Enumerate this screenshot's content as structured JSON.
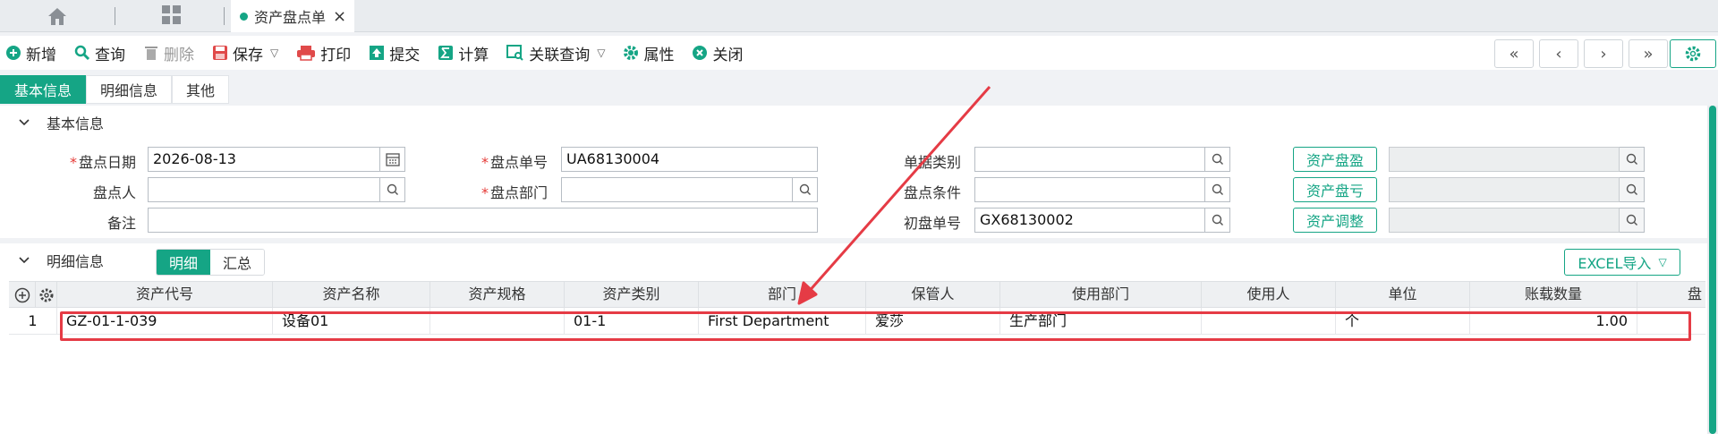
{
  "tabbar": {
    "active_tab": "资产盘点单",
    "close_glyph": "×"
  },
  "toolbar": {
    "new": "新增",
    "query": "查询",
    "delete": "删除",
    "save": "保存",
    "print": "打印",
    "submit": "提交",
    "calculate": "计算",
    "related_query": "关联查询",
    "properties": "属性",
    "close": "关闭",
    "nav_first": "«",
    "nav_prev": "‹",
    "nav_next": "›",
    "nav_last": "»"
  },
  "section_tabs": [
    "基本信息",
    "明细信息",
    "其他"
  ],
  "basic": {
    "title": "基本信息",
    "fields": {
      "date_label": "盘点日期",
      "date_value": "2026-08-13",
      "number_label": "盘点单号",
      "number_value": "UA68130004",
      "doc_type_label": "单据类别",
      "doc_type_value": "",
      "person_label": "盘点人",
      "person_value": "",
      "dept_label": "盘点部门",
      "dept_value": "",
      "condition_label": "盘点条件",
      "condition_value": "",
      "remark_label": "备注",
      "remark_value": "",
      "initial_no_label": "初盘单号",
      "initial_no_value": "GX68130002"
    },
    "buttons": {
      "surplus": "资产盘盈",
      "loss": "资产盘亏",
      "adjust": "资产调整"
    }
  },
  "detail": {
    "title": "明细信息",
    "subtabs": [
      "明细",
      "汇总"
    ],
    "excel_import": "EXCEL导入",
    "columns": [
      "资产代号",
      "资产名称",
      "资产规格",
      "资产类别",
      "部门",
      "保管人",
      "使用部门",
      "使用人",
      "单位",
      "账载数量",
      "盘"
    ],
    "rows": [
      {
        "index": "1",
        "code": "GZ-01-1-039",
        "name": "设备01",
        "spec": "",
        "category": "01-1",
        "dept": "First Department",
        "keeper": "爱莎",
        "use_dept": "生产部门",
        "user": "",
        "unit": "个",
        "qty": "1.00",
        "extra": ""
      }
    ]
  },
  "colors": {
    "accent": "#15a585",
    "highlight": "#e53b45",
    "required": "#e53935"
  }
}
